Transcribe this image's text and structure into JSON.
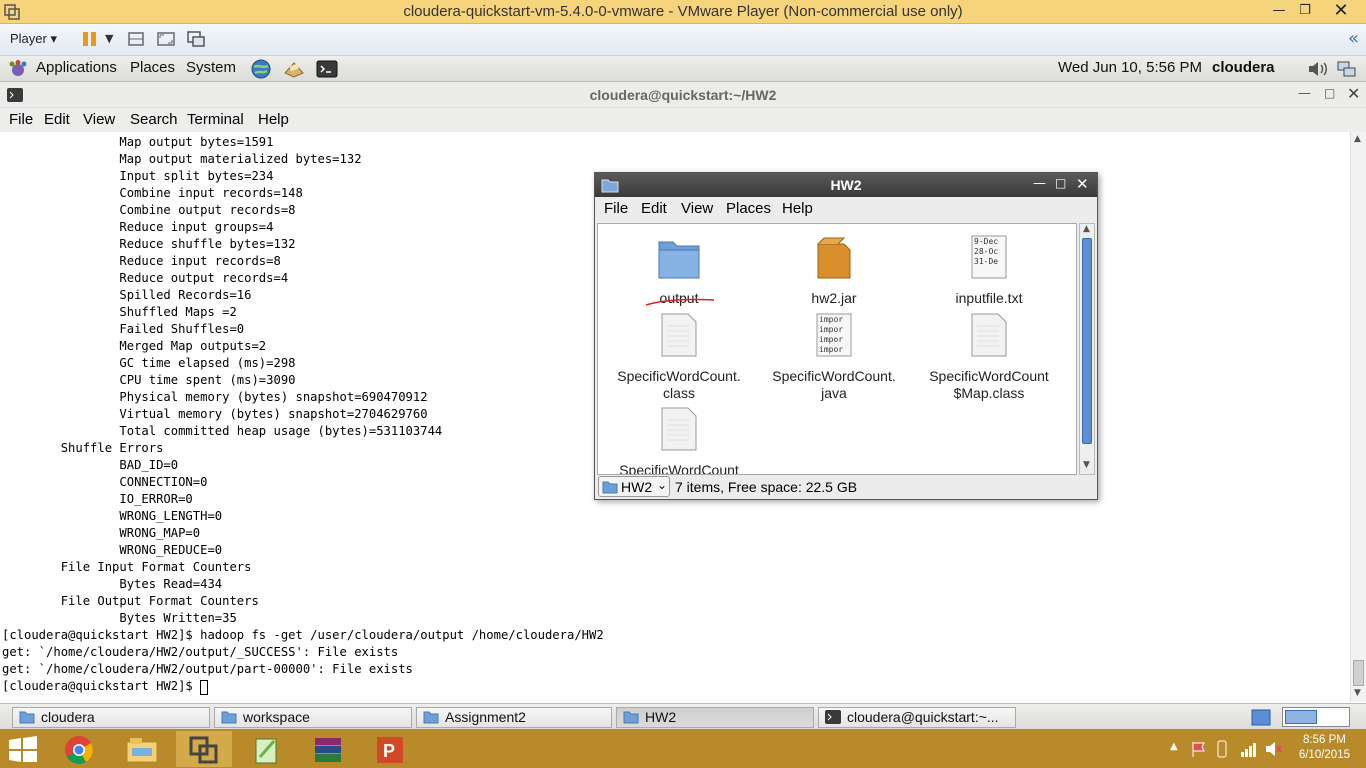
{
  "vm": {
    "title": "cloudera-quickstart-vm-5.4.0-0-vmware - VMware Player (Non-commercial use only)",
    "player_label": "Player"
  },
  "gnome_panel": {
    "applications": "Applications",
    "places": "Places",
    "system": "System",
    "datetime": "Wed Jun 10,  5:56 PM",
    "user": "cloudera"
  },
  "terminal": {
    "title": "cloudera@quickstart:~/HW2",
    "menu": [
      "File",
      "Edit",
      "View",
      "Search",
      "Terminal",
      "Help"
    ],
    "lines": [
      "                Map output bytes=1591",
      "                Map output materialized bytes=132",
      "                Input split bytes=234",
      "                Combine input records=148",
      "                Combine output records=8",
      "                Reduce input groups=4",
      "                Reduce shuffle bytes=132",
      "                Reduce input records=8",
      "                Reduce output records=4",
      "                Spilled Records=16",
      "                Shuffled Maps =2",
      "                Failed Shuffles=0",
      "                Merged Map outputs=2",
      "                GC time elapsed (ms)=298",
      "                CPU time spent (ms)=3090",
      "                Physical memory (bytes) snapshot=690470912",
      "                Virtual memory (bytes) snapshot=2704629760",
      "                Total committed heap usage (bytes)=531103744",
      "        Shuffle Errors",
      "                BAD_ID=0",
      "                CONNECTION=0",
      "                IO_ERROR=0",
      "                WRONG_LENGTH=0",
      "                WRONG_MAP=0",
      "                WRONG_REDUCE=0",
      "        File Input Format Counters",
      "                Bytes Read=434",
      "        File Output Format Counters",
      "                Bytes Written=35",
      "[cloudera@quickstart HW2]$ hadoop fs -get /user/cloudera/output /home/cloudera/HW2",
      "get: `/home/cloudera/HW2/output/_SUCCESS': File exists",
      "get: `/home/cloudera/HW2/output/part-00000': File exists",
      "[cloudera@quickstart HW2]$ "
    ]
  },
  "file_manager": {
    "title": "HW2",
    "menu": [
      "File",
      "Edit",
      "View",
      "Places",
      "Help"
    ],
    "items": [
      {
        "name": "output",
        "kind": "folder"
      },
      {
        "name": "hw2.jar",
        "kind": "jar"
      },
      {
        "name": "inputfile.txt",
        "kind": "text",
        "preview": [
          "9-Dec",
          "28-Oc",
          "31-De"
        ]
      },
      {
        "name": "SpecificWordCount.\nclass",
        "kind": "file"
      },
      {
        "name": "SpecificWordCount.\njava",
        "kind": "text",
        "preview": [
          "impor",
          "impor",
          "impor",
          "impor"
        ]
      },
      {
        "name": "SpecificWordCount\n$Map.class",
        "kind": "file"
      },
      {
        "name": "SpecificWordCount\n$Reduce.class",
        "kind": "file"
      }
    ],
    "location": "HW2",
    "status": "7 items, Free space: 22.5 GB"
  },
  "taskbar": {
    "tasks": [
      "cloudera",
      "workspace",
      "Assignment2",
      "HW2",
      "cloudera@quickstart:~..."
    ]
  },
  "windows": {
    "clock_time": "8:56 PM",
    "clock_date": "6/10/2015"
  },
  "colors": {
    "vm_title_bg": "#f6d47c",
    "win_taskbar": "#b88a2a",
    "annotation_red": "#e02020"
  }
}
